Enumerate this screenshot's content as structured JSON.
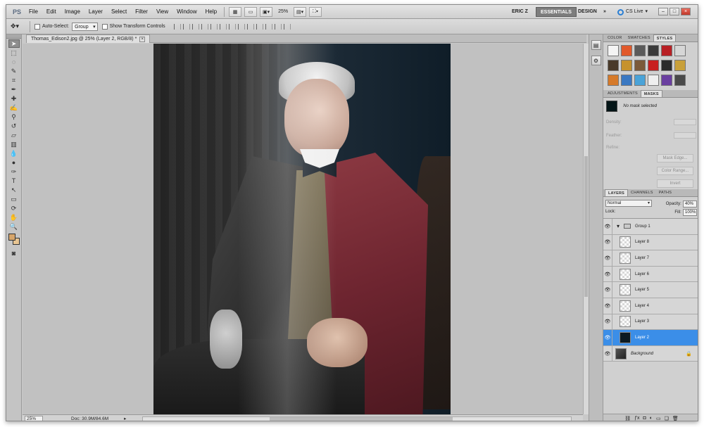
{
  "app": {
    "logo": "PS",
    "menu": [
      "File",
      "Edit",
      "Image",
      "Layer",
      "Select",
      "Filter",
      "View",
      "Window",
      "Help"
    ],
    "zoom": "25%",
    "workspaces": [
      "ERIC Z",
      "ESSENTIALS",
      "DESIGN"
    ],
    "more": "»",
    "cs_live": "CS Live"
  },
  "options": {
    "auto_select_label": "Auto-Select:",
    "auto_select_value": "Group",
    "transform_label": "Show Transform Controls"
  },
  "document": {
    "tab_title": "Thomas_Edison2.jpg @ 25% (Layer 2, RGB/8) *",
    "status_zoom": "25%",
    "status_doc": "Doc: 30.9M/84.6M"
  },
  "panels": {
    "swatch_tabs": [
      "COLOR",
      "SWATCHES",
      "STYLES"
    ],
    "adjust_tabs": [
      "ADJUSTMENTS",
      "MASKS"
    ],
    "no_mask": "No mask selected",
    "density_label": "Density:",
    "feather_label": "Feather:",
    "refine_label": "Refine:",
    "mask_edge": "Mask Edge...",
    "color_range": "Color Range...",
    "invert": "Invert",
    "layer_tabs": [
      "LAYERS",
      "CHANNELS",
      "PATHS"
    ],
    "blend_mode": "Normal",
    "opacity_label": "Opacity:",
    "opacity_value": "40%",
    "lock_label": "Lock:",
    "fill_label": "Fill:",
    "fill_value": "100%",
    "layers": [
      {
        "name": "Group 1",
        "kind": "group"
      },
      {
        "name": "Layer 8",
        "kind": "layer"
      },
      {
        "name": "Layer 7",
        "kind": "layer"
      },
      {
        "name": "Layer 6",
        "kind": "layer"
      },
      {
        "name": "Layer 5",
        "kind": "layer"
      },
      {
        "name": "Layer 4",
        "kind": "layer"
      },
      {
        "name": "Layer 3",
        "kind": "layer"
      },
      {
        "name": "Layer 2",
        "kind": "layer",
        "selected": true
      },
      {
        "name": "Background",
        "kind": "background"
      }
    ]
  },
  "style_colors": [
    "#f4f4f4",
    "#e1592b",
    "#5a5a5a",
    "#3a3a3a",
    "#b81f24",
    "#d6d6d6",
    "#4a3a2a",
    "#c6922d",
    "#7b5a3a",
    "#c82020",
    "#2b2b2b",
    "#c8a03a",
    "#d67a2a",
    "#3a78c2",
    "#4aa3d8",
    "#efefef",
    "#6a3fa0",
    "#4a4a4a"
  ],
  "colors": {
    "selected_layer": "#3b8ee8",
    "foreground": "#d6a56a",
    "background": "#e8c592"
  }
}
